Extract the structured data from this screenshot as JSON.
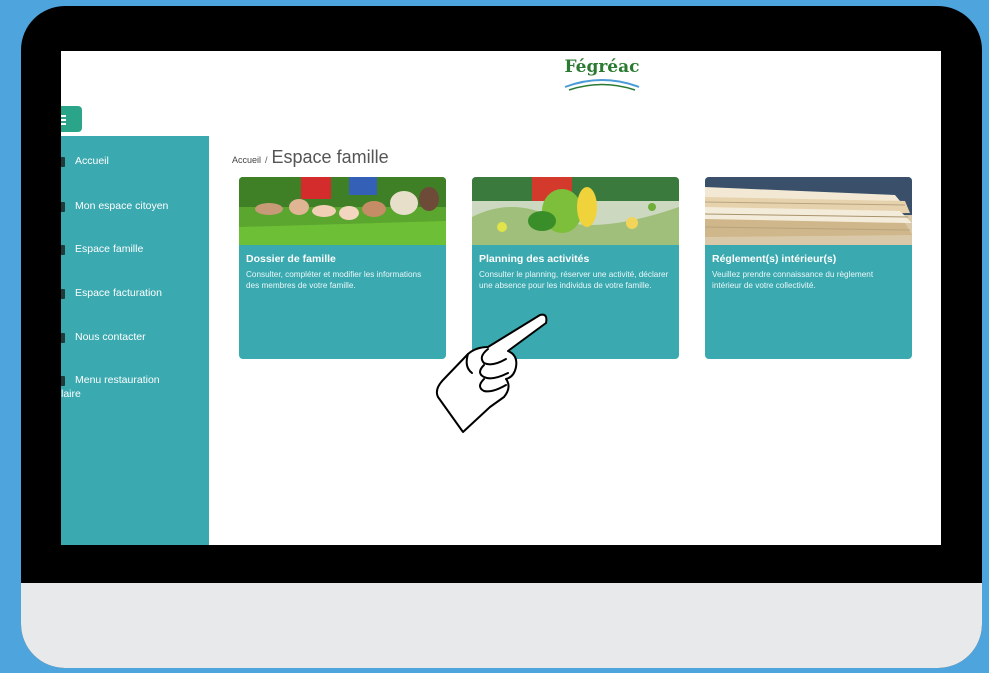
{
  "app": {
    "logo_text": "Fégréac"
  },
  "sidebar": {
    "items": [
      {
        "label": "Accueil",
        "icon": "home-icon"
      },
      {
        "label": "Mon espace citoyen",
        "icon": "user-icon"
      },
      {
        "label": "Espace famille",
        "icon": "family-icon"
      },
      {
        "label": "Espace facturation",
        "icon": "euro-icon"
      },
      {
        "label": "Nous contacter",
        "icon": "envelope-icon"
      },
      {
        "label": "Menu restauration",
        "label2": "laire",
        "icon": "utensils-icon"
      }
    ]
  },
  "breadcrumb": {
    "home": "Accueil",
    "separator": "/",
    "current": "Espace famille"
  },
  "cards": [
    {
      "title": "Dossier de famille",
      "desc": "Consulter, compléter et modifier les informations des membres de votre famille."
    },
    {
      "title": "Planning des activités",
      "desc": "Consulter le planning, réserver une activité, déclarer une absence pour les individus de votre famille."
    },
    {
      "title": "Réglement(s) intérieur(s)",
      "desc": "Veuillez prendre connaissance du règlement intérieur de votre collectivité."
    }
  ],
  "colors": {
    "background": "#4ea4dc",
    "teal": "#3aa9b0",
    "menu_green": "#2ba58a",
    "logo_green": "#2a7b31"
  }
}
